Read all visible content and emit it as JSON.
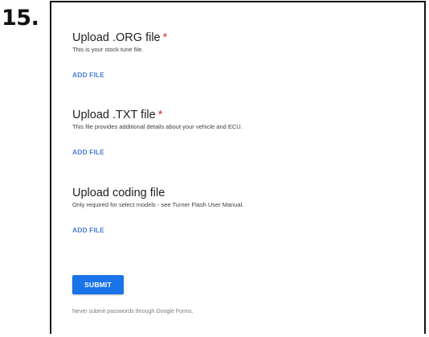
{
  "step_number": "15.",
  "form": {
    "sections": [
      {
        "title": "Upload .ORG file",
        "required_marker": "*",
        "description": "This is your stock tune file.",
        "add_file_label": "ADD FILE"
      },
      {
        "title": "Upload .TXT file",
        "required_marker": "*",
        "description": "This file provides additional details about your vehicle and ECU.",
        "add_file_label": "ADD FILE"
      },
      {
        "title": "Upload coding file",
        "description": "Only required for select models - see Turner Flash User Manual.",
        "add_file_label": "ADD FILE"
      }
    ],
    "submit_label": "SUBMIT",
    "footer_note": "Never submit passwords through Google Forms."
  },
  "colors": {
    "accent": "#1a73e8",
    "link": "#4a7fd8",
    "required": "#d93025"
  }
}
